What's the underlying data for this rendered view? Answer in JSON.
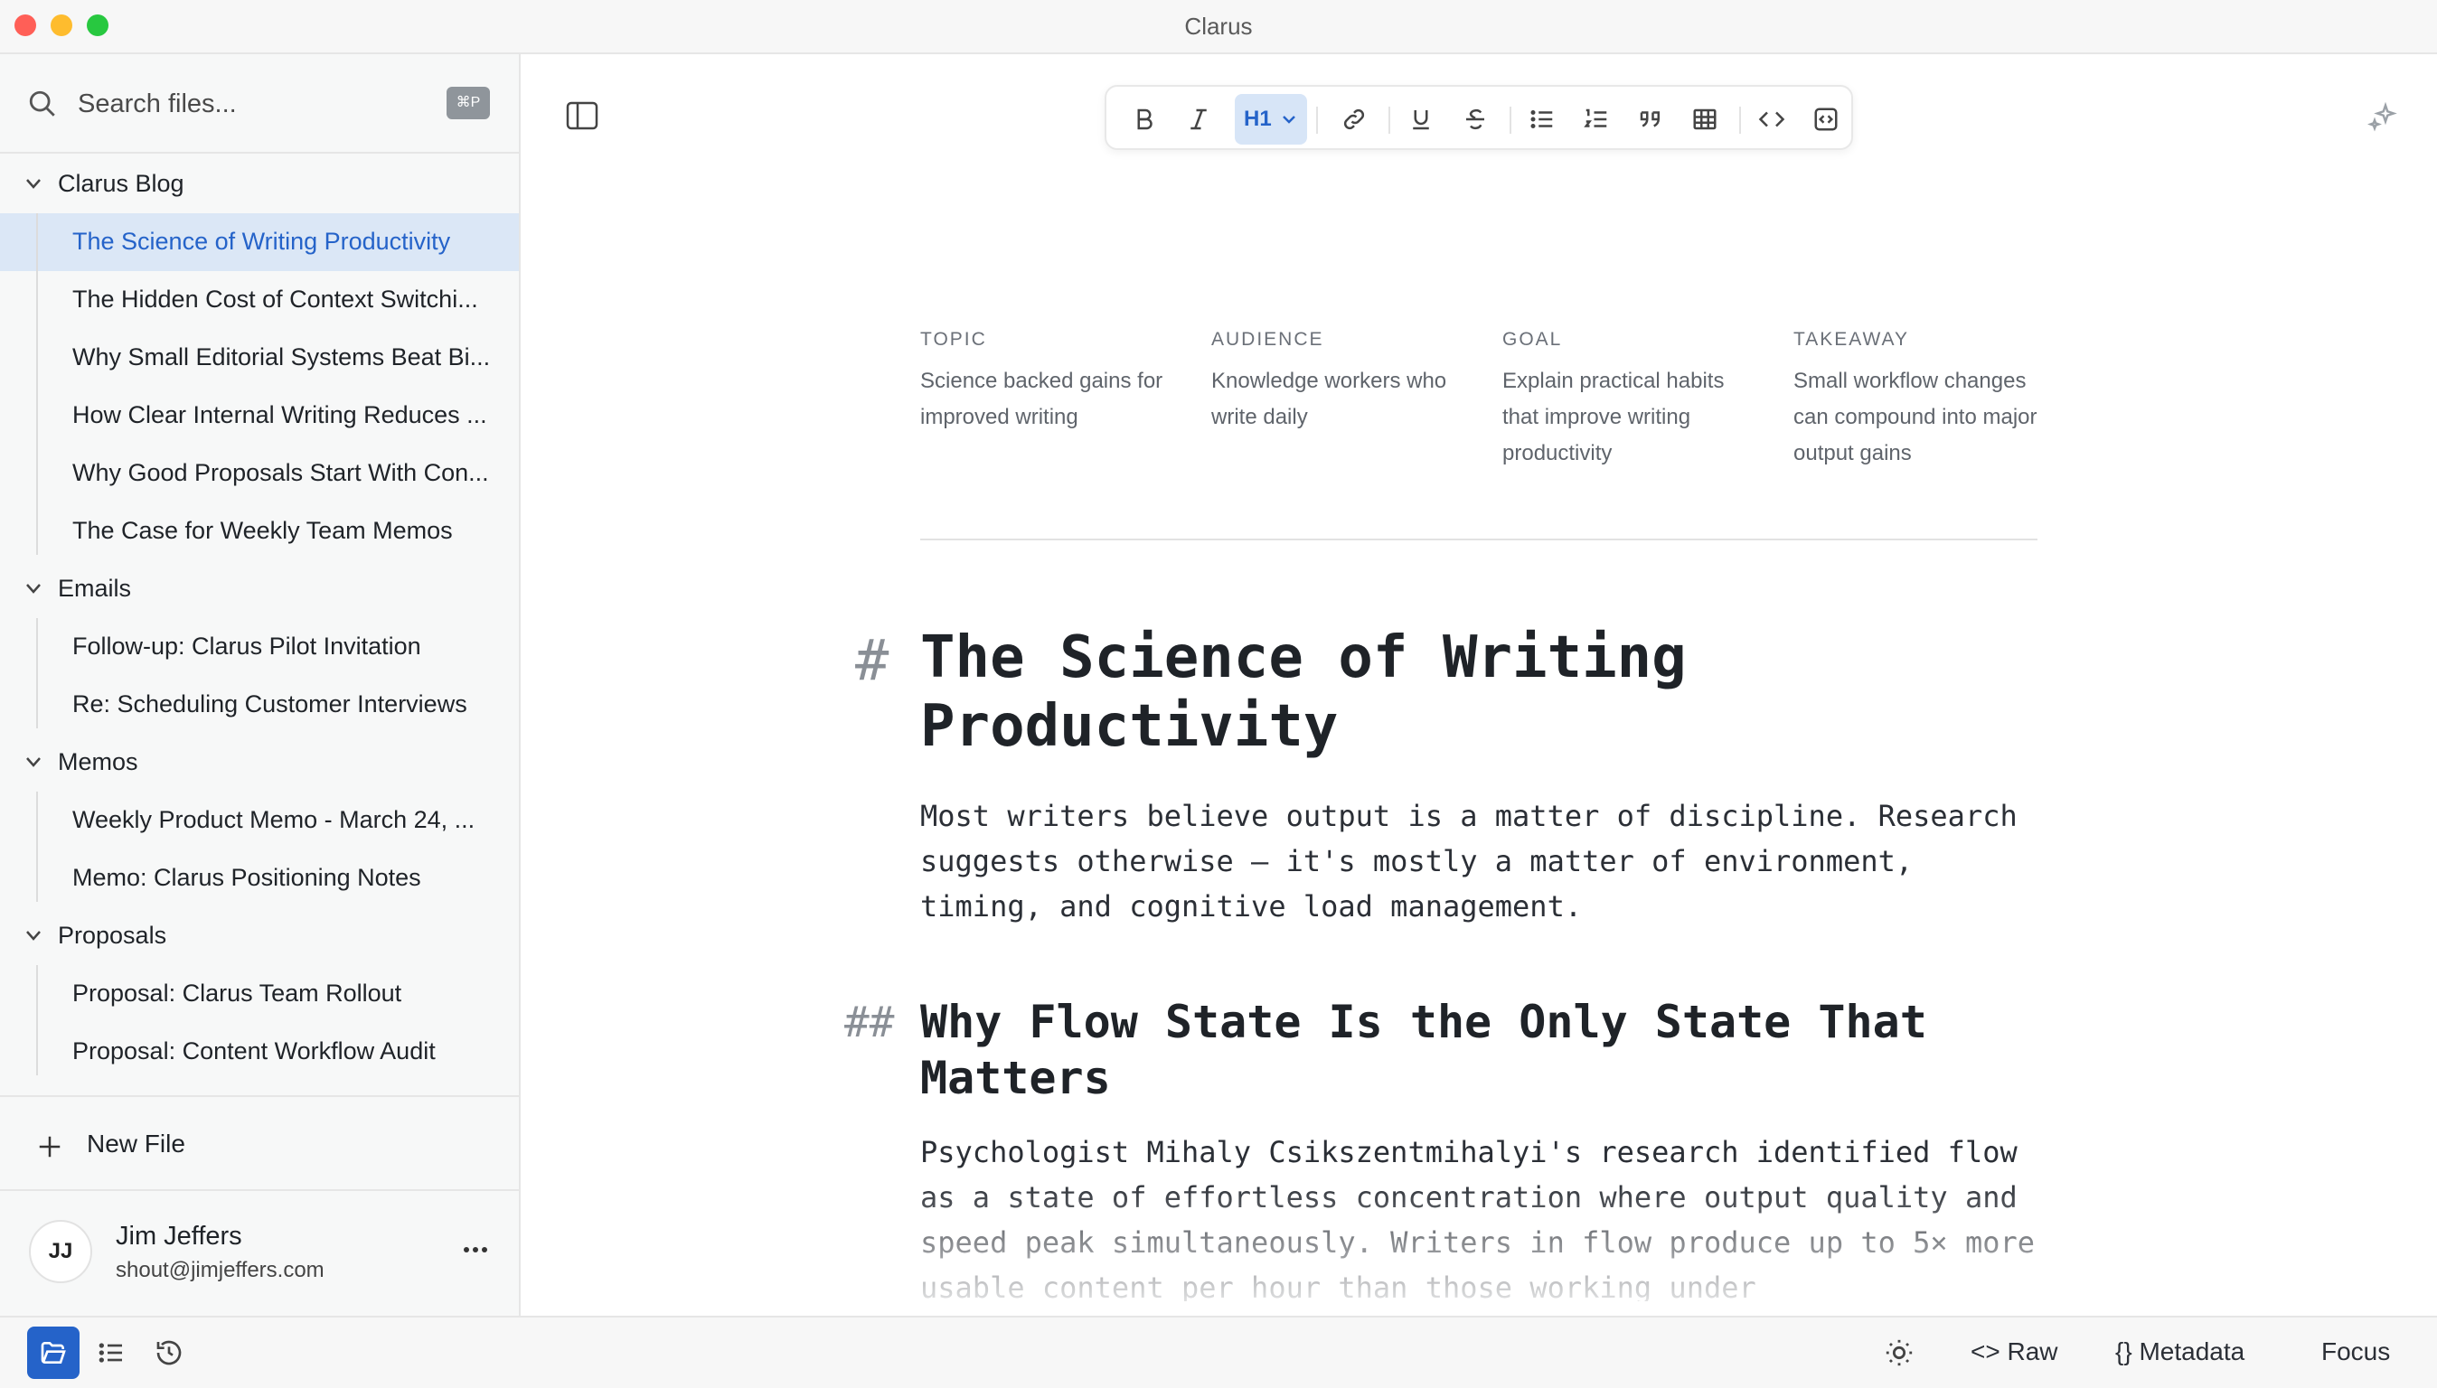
{
  "window": {
    "title": "Clarus"
  },
  "search": {
    "placeholder": "Search files...",
    "shortcut": "⌘P"
  },
  "tree": {
    "groups": [
      {
        "label": "Clarus Blog",
        "items": [
          {
            "label": "The Science of Writing Productivity",
            "active": true
          },
          {
            "label": "The Hidden Cost of Context Switchi..."
          },
          {
            "label": "Why Small Editorial Systems Beat Bi..."
          },
          {
            "label": "How Clear Internal Writing Reduces ..."
          },
          {
            "label": "Why Good Proposals Start With Con..."
          },
          {
            "label": "The Case for Weekly Team Memos"
          }
        ]
      },
      {
        "label": "Emails",
        "items": [
          {
            "label": "Follow-up: Clarus Pilot Invitation"
          },
          {
            "label": "Re: Scheduling Customer Interviews"
          }
        ]
      },
      {
        "label": "Memos",
        "items": [
          {
            "label": "Weekly Product Memo - March 24, ..."
          },
          {
            "label": "Memo: Clarus Positioning Notes"
          }
        ]
      },
      {
        "label": "Proposals",
        "items": [
          {
            "label": "Proposal: Clarus Team Rollout"
          },
          {
            "label": "Proposal: Content Workflow Audit"
          }
        ]
      }
    ]
  },
  "new_file": {
    "label": "New File"
  },
  "user": {
    "initials": "JJ",
    "name": "Jim Jeffers",
    "email": "shout@jimjeffers.com"
  },
  "toolbar": {
    "heading_level": "H1"
  },
  "metadata": [
    {
      "key": "TOPIC",
      "value": "Science backed gains for improved writing"
    },
    {
      "key": "AUDIENCE",
      "value": "Knowledge workers who write daily"
    },
    {
      "key": "GOAL",
      "value": "Explain practical habits that improve writing productivity"
    },
    {
      "key": "TAKEAWAY",
      "value": "Small workflow changes can compound into major output gains"
    }
  ],
  "document": {
    "h1_marker": "#",
    "h1": "The Science of Writing Productivity",
    "p1": "Most writers believe output is a matter of discipline. Research suggests otherwise — it's mostly a matter of environment, timing, and cognitive load management.",
    "h2_marker": "##",
    "h2": "Why Flow State Is the Only State That Matters",
    "p2": "Psychologist Mihaly Csikszentmihalyi's research identified flow as a state of effortless concentration where output quality and speed peak simultaneously. Writers in flow produce up to 5× more usable content per hour than those working under"
  },
  "bottom_bar": {
    "raw": "Raw",
    "metadata": "Metadata",
    "focus": "Focus"
  },
  "colors": {
    "accent": "#2563c9",
    "active_bg": "#dbe7f6",
    "sidebar_bg": "#f7f8f8"
  }
}
